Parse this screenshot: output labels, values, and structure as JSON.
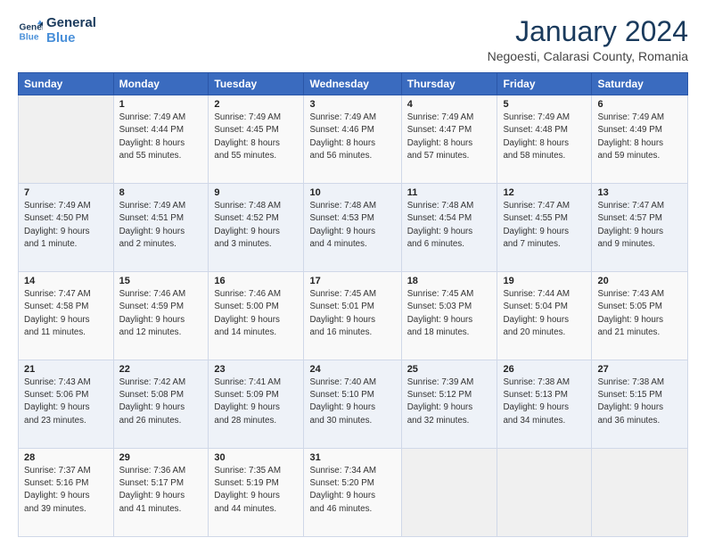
{
  "logo": {
    "line1": "General",
    "line2": "Blue"
  },
  "title": "January 2024",
  "subtitle": "Negoesti, Calarasi County, Romania",
  "header_days": [
    "Sunday",
    "Monday",
    "Tuesday",
    "Wednesday",
    "Thursday",
    "Friday",
    "Saturday"
  ],
  "weeks": [
    [
      {
        "day": null,
        "info": ""
      },
      {
        "day": "1",
        "info": "Sunrise: 7:49 AM\nSunset: 4:44 PM\nDaylight: 8 hours\nand 55 minutes."
      },
      {
        "day": "2",
        "info": "Sunrise: 7:49 AM\nSunset: 4:45 PM\nDaylight: 8 hours\nand 55 minutes."
      },
      {
        "day": "3",
        "info": "Sunrise: 7:49 AM\nSunset: 4:46 PM\nDaylight: 8 hours\nand 56 minutes."
      },
      {
        "day": "4",
        "info": "Sunrise: 7:49 AM\nSunset: 4:47 PM\nDaylight: 8 hours\nand 57 minutes."
      },
      {
        "day": "5",
        "info": "Sunrise: 7:49 AM\nSunset: 4:48 PM\nDaylight: 8 hours\nand 58 minutes."
      },
      {
        "day": "6",
        "info": "Sunrise: 7:49 AM\nSunset: 4:49 PM\nDaylight: 8 hours\nand 59 minutes."
      }
    ],
    [
      {
        "day": "7",
        "info": "Sunrise: 7:49 AM\nSunset: 4:50 PM\nDaylight: 9 hours\nand 1 minute."
      },
      {
        "day": "8",
        "info": "Sunrise: 7:49 AM\nSunset: 4:51 PM\nDaylight: 9 hours\nand 2 minutes."
      },
      {
        "day": "9",
        "info": "Sunrise: 7:48 AM\nSunset: 4:52 PM\nDaylight: 9 hours\nand 3 minutes."
      },
      {
        "day": "10",
        "info": "Sunrise: 7:48 AM\nSunset: 4:53 PM\nDaylight: 9 hours\nand 4 minutes."
      },
      {
        "day": "11",
        "info": "Sunrise: 7:48 AM\nSunset: 4:54 PM\nDaylight: 9 hours\nand 6 minutes."
      },
      {
        "day": "12",
        "info": "Sunrise: 7:47 AM\nSunset: 4:55 PM\nDaylight: 9 hours\nand 7 minutes."
      },
      {
        "day": "13",
        "info": "Sunrise: 7:47 AM\nSunset: 4:57 PM\nDaylight: 9 hours\nand 9 minutes."
      }
    ],
    [
      {
        "day": "14",
        "info": "Sunrise: 7:47 AM\nSunset: 4:58 PM\nDaylight: 9 hours\nand 11 minutes."
      },
      {
        "day": "15",
        "info": "Sunrise: 7:46 AM\nSunset: 4:59 PM\nDaylight: 9 hours\nand 12 minutes."
      },
      {
        "day": "16",
        "info": "Sunrise: 7:46 AM\nSunset: 5:00 PM\nDaylight: 9 hours\nand 14 minutes."
      },
      {
        "day": "17",
        "info": "Sunrise: 7:45 AM\nSunset: 5:01 PM\nDaylight: 9 hours\nand 16 minutes."
      },
      {
        "day": "18",
        "info": "Sunrise: 7:45 AM\nSunset: 5:03 PM\nDaylight: 9 hours\nand 18 minutes."
      },
      {
        "day": "19",
        "info": "Sunrise: 7:44 AM\nSunset: 5:04 PM\nDaylight: 9 hours\nand 20 minutes."
      },
      {
        "day": "20",
        "info": "Sunrise: 7:43 AM\nSunset: 5:05 PM\nDaylight: 9 hours\nand 21 minutes."
      }
    ],
    [
      {
        "day": "21",
        "info": "Sunrise: 7:43 AM\nSunset: 5:06 PM\nDaylight: 9 hours\nand 23 minutes."
      },
      {
        "day": "22",
        "info": "Sunrise: 7:42 AM\nSunset: 5:08 PM\nDaylight: 9 hours\nand 26 minutes."
      },
      {
        "day": "23",
        "info": "Sunrise: 7:41 AM\nSunset: 5:09 PM\nDaylight: 9 hours\nand 28 minutes."
      },
      {
        "day": "24",
        "info": "Sunrise: 7:40 AM\nSunset: 5:10 PM\nDaylight: 9 hours\nand 30 minutes."
      },
      {
        "day": "25",
        "info": "Sunrise: 7:39 AM\nSunset: 5:12 PM\nDaylight: 9 hours\nand 32 minutes."
      },
      {
        "day": "26",
        "info": "Sunrise: 7:38 AM\nSunset: 5:13 PM\nDaylight: 9 hours\nand 34 minutes."
      },
      {
        "day": "27",
        "info": "Sunrise: 7:38 AM\nSunset: 5:15 PM\nDaylight: 9 hours\nand 36 minutes."
      }
    ],
    [
      {
        "day": "28",
        "info": "Sunrise: 7:37 AM\nSunset: 5:16 PM\nDaylight: 9 hours\nand 39 minutes."
      },
      {
        "day": "29",
        "info": "Sunrise: 7:36 AM\nSunset: 5:17 PM\nDaylight: 9 hours\nand 41 minutes."
      },
      {
        "day": "30",
        "info": "Sunrise: 7:35 AM\nSunset: 5:19 PM\nDaylight: 9 hours\nand 44 minutes."
      },
      {
        "day": "31",
        "info": "Sunrise: 7:34 AM\nSunset: 5:20 PM\nDaylight: 9 hours\nand 46 minutes."
      },
      {
        "day": null,
        "info": ""
      },
      {
        "day": null,
        "info": ""
      },
      {
        "day": null,
        "info": ""
      }
    ]
  ]
}
